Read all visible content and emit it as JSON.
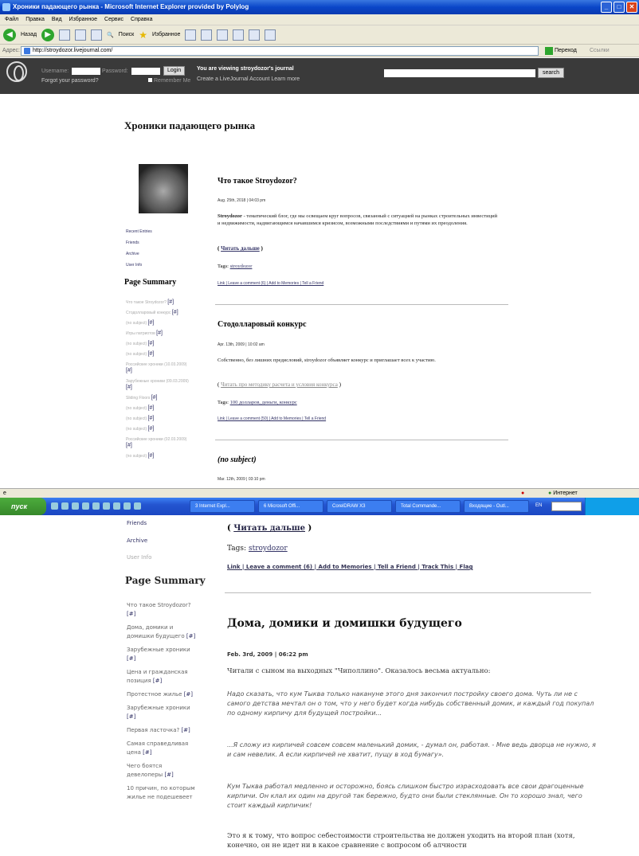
{
  "window": {
    "title": "Хроники падающего рынка - Microsoft Internet Explorer provided by Polylog"
  },
  "menu": [
    "Файл",
    "Правка",
    "Вид",
    "Избранное",
    "Сервис",
    "Справка"
  ],
  "toolbar": {
    "back": "Назад",
    "search": "Поиск",
    "favorites": "Избранное"
  },
  "address": {
    "label": "Адрес:",
    "url": "http://stroydozor.livejournal.com/",
    "go": "Переход",
    "links": "Ссылки"
  },
  "lj": {
    "username_label": "Username:",
    "password_label": "Password:",
    "login": "Login",
    "forgot": "Forgot your password?",
    "remember": "Remember Me",
    "viewing": "You are viewing  stroydozor's journal",
    "create": "Create a LiveJournal Account   Learn more",
    "search": "search"
  },
  "journal": {
    "title": "Хроники падающего рынка",
    "nav": [
      "Recent Entries",
      "Friends",
      "Archive",
      "User Info"
    ],
    "page_summary_title": "Page Summary",
    "summary": [
      "Что такое Stroydozor?",
      "Стодолларовый конкурс",
      "(no subject)",
      "Игры патриотов",
      "(no subject)",
      "(no subject)",
      "Российские хроники (10.03.2009)",
      "Зарубежные хроники (09.03.2009)",
      "Sliding Floors",
      "(no subject)",
      "(no subject)",
      "(no subject)",
      "Российские хроники (02.03.2009)",
      "(no subject)"
    ],
    "summary_link": "[#]"
  },
  "entries": [
    {
      "title": "Что такое Stroydozor?",
      "date": "Aug. 25th, 2018 | 04:03 pm",
      "body_bold": "Stroydozor",
      "body": " - тематический блог, где мы освещаем круг вопросов, связанный с ситуацией на рынках строительных инвестиций и недвижимости, надвигающимся начавшимся кризисом, возможными последствиями и путями их преодоления.",
      "more": "Читать дальше",
      "tags_label": "Tags:",
      "tags": "stroydozor",
      "links": "Link | Leave a comment (6) | Add to Memories | Tell a Friend"
    },
    {
      "title": "Стодолларовый конкурс",
      "date": "Apr. 13th, 2009 | 10:02 am",
      "body": "Собственно, без лишних предисловий, stroydozor объявляет конкурс и приглашает всех к участию.",
      "more": "Читать про методику расчета и условия конкурса",
      "tags_label": "Tags:",
      "tags": "100 долларов, деньги, конкурс",
      "links": "Link | Leave a comment (50) | Add to Memories | Tell a Friend"
    },
    {
      "title": "(no subject)",
      "date": "Mar. 12th, 2009 | 03:10 pm"
    }
  ],
  "statusbar": {
    "zone": "Интернет"
  },
  "taskbar": {
    "start": "пуск",
    "tasks": [
      "3 Internet Expl...",
      "6 Microsoft Offi...",
      "CorelDRAW X3",
      "Total Commande...",
      "Входящие - Outl..."
    ],
    "lang": "EN"
  },
  "second": {
    "friends": "Friends",
    "archive": "Archive",
    "userinfo": "User Info",
    "page_summary_title": "Page Summary",
    "summary": [
      "Что такое Stroydozor?",
      "Дома, домики и домишки будущего",
      "Зарубежные хроники",
      "Цена и гражданская позиция",
      "Протестное жилье",
      "Зарубежные хроники",
      "Первая ласточка?",
      "Самая справедливая цена",
      "Чего боятся девелоперы",
      "10 причин, по которым жилье не подешевеет"
    ],
    "summary_link": "[#]",
    "more": "Читать дальше",
    "tags_label": "Tags:",
    "tags": "stroydozor",
    "links": "Link | Leave a comment (6) | Add to Memories | Tell a Friend | Track This | Flag",
    "entry_title": "Дома, домики и домишки будущего",
    "entry_date": "Feb. 3rd, 2009 | 06:22 pm",
    "p1": "Читали с сыном на выходных \"Чиполлино\". Оказалось весьма актуально:",
    "q1": "Надо сказать, что кум Тыква только накануне этого дня закончил постройку своего дома. Чуть ли не с самого детства мечтал он о том, что у него будет когда нибудь собственный домик, и каждый год покупал по одному кирпичу для будущей постройки...",
    "q2": "...Я сложу из кирпичей совсем совсем маленький домик, - думал он, работая. - Мне ведь дворца не нужно, я и сам невелик. А если кирпичей не хватит, пущу в ход бумагу».",
    "q3": "Кум Тыква работал медленно и осторожно, боясь слишком быстро израсходовать все свои драгоценные кирпичи. Он клал их один на другой так бережно, будто они были стеклянные. Он то хорошо знал, чего стоит каждый кирпичик!",
    "p2": "Это я к тому, что вопрос себестоимости строительства не должен уходить на второй план (хотя, конечно, он не идет ни в какое сравнение с вопросом об алчности"
  }
}
